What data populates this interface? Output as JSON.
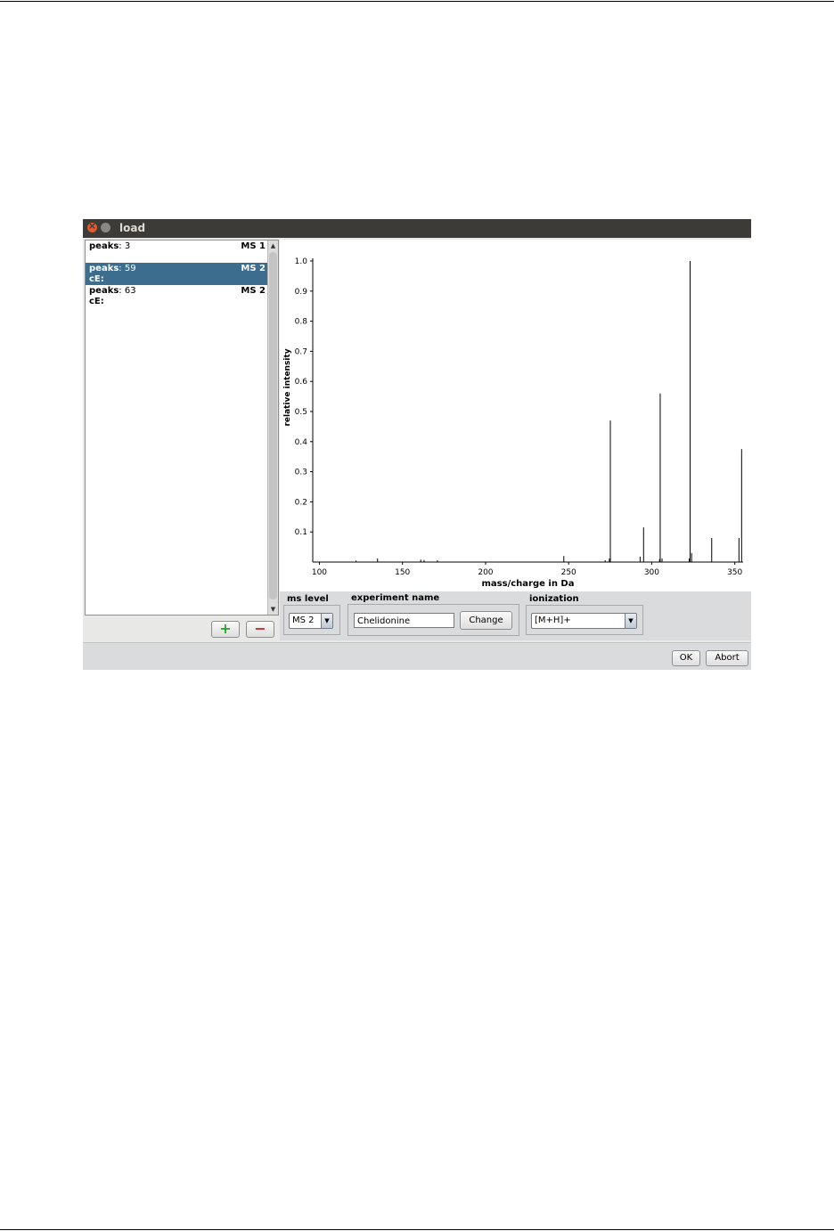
{
  "window": {
    "title": "load"
  },
  "spectra_list": {
    "items": [
      {
        "peaks_label": "peaks",
        "peaks_value": ": 3",
        "ms_level": "MS 1",
        "ce": "",
        "selected": false
      },
      {
        "peaks_label": "peaks",
        "peaks_value": ": 59",
        "ms_level": "MS 2",
        "ce": "cE:",
        "selected": true
      },
      {
        "peaks_label": "peaks",
        "peaks_value": ": 63",
        "ms_level": "MS 2",
        "ce": "cE:",
        "selected": false
      }
    ],
    "add_label": "+",
    "remove_label": "−"
  },
  "settings": {
    "ms_level_label": "ms level",
    "ms_level_value": "MS 2",
    "experiment_name_label": "experiment name",
    "experiment_name_value": "Chelidonine",
    "change_label": "Change",
    "ionization_label": "ionization",
    "ionization_value": "[M+H]+"
  },
  "footer": {
    "ok_label": "OK",
    "abort_label": "Abort"
  },
  "chart_data": {
    "type": "bar",
    "xlabel": "mass/charge in Da",
    "ylabel": "relative intensity",
    "xlim": [
      96,
      355
    ],
    "ylim": [
      0,
      1.0
    ],
    "xticks": [
      100,
      150,
      200,
      250,
      300,
      350
    ],
    "yticks": [
      0.1,
      0.2,
      0.3,
      0.4,
      0.5,
      0.6,
      0.7,
      0.8,
      0.9,
      1.0
    ],
    "ytick_labels": [
      "0.1",
      "0.2",
      "0.3",
      "0.4",
      "0.5",
      "0.6",
      "0.7",
      "0.8",
      "0.9",
      "1.0"
    ],
    "peaks": [
      {
        "mz": 122.0,
        "y": 0.005
      },
      {
        "mz": 135.0,
        "y": 0.012
      },
      {
        "mz": 161.0,
        "y": 0.008
      },
      {
        "mz": 163.0,
        "y": 0.007
      },
      {
        "mz": 171.0,
        "y": 0.006
      },
      {
        "mz": 247.1,
        "y": 0.02
      },
      {
        "mz": 272.0,
        "y": 0.006
      },
      {
        "mz": 274.5,
        "y": 0.012
      },
      {
        "mz": 275.1,
        "y": 0.47
      },
      {
        "mz": 293.0,
        "y": 0.018
      },
      {
        "mz": 295.1,
        "y": 0.115
      },
      {
        "mz": 304.7,
        "y": 0.01
      },
      {
        "mz": 305.1,
        "y": 0.56
      },
      {
        "mz": 306.2,
        "y": 0.012
      },
      {
        "mz": 322.5,
        "y": 0.012
      },
      {
        "mz": 323.1,
        "y": 1.0
      },
      {
        "mz": 324.0,
        "y": 0.03
      },
      {
        "mz": 336.1,
        "y": 0.08
      },
      {
        "mz": 352.5,
        "y": 0.08
      },
      {
        "mz": 354.1,
        "y": 0.375
      }
    ],
    "grid": false
  }
}
